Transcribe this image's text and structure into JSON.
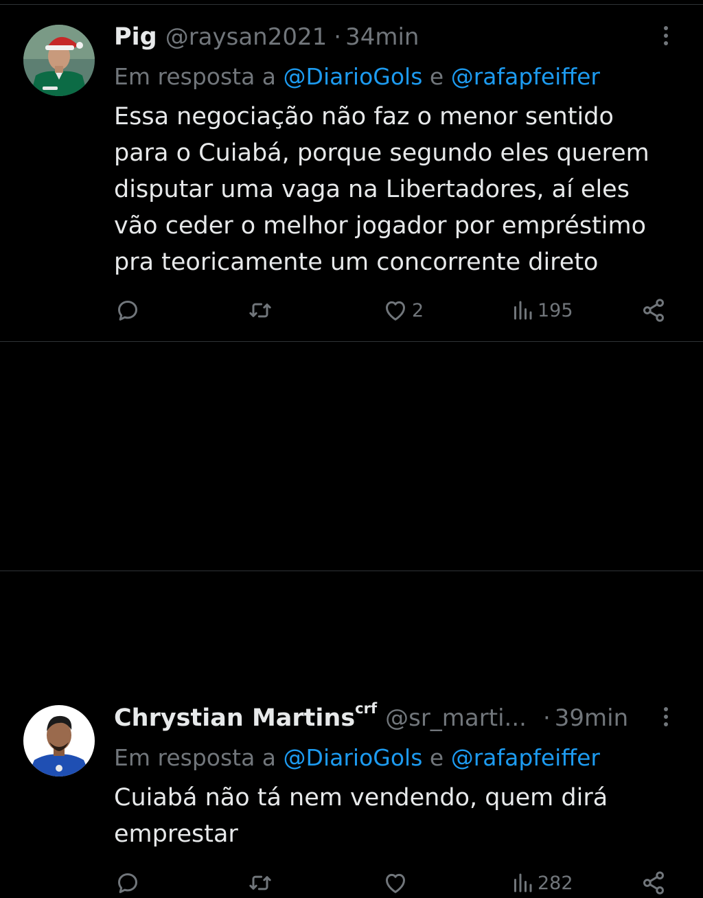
{
  "tweets": [
    {
      "name": "Pig",
      "name_sup": "",
      "handle": "@raysan2021",
      "dot": "·",
      "time": "34min",
      "reply_prefix": "Em resposta a ",
      "reply_mention_1": "@DiarioGols",
      "reply_and": " e ",
      "reply_mention_2": "@rafapfeiffer",
      "text": "Essa negociação não faz o menor sentido\npara o Cuiabá, porque segundo eles querem\ndisputar uma vaga na Libertadores, aí eles\nvão ceder o melhor jogador por empréstimo\npra teoricamente um concorrente direto",
      "likes": "2",
      "views": "195",
      "avatar_colors": {
        "bg": "#5d7f72",
        "jersey": "#0c6b45",
        "hat": "#c62828"
      }
    },
    {
      "name": "Chrystian Martins",
      "name_sup": "crf",
      "handle": "@sr_marti...",
      "dot": "·",
      "time": "39min",
      "reply_prefix": "Em resposta a ",
      "reply_mention_1": "@DiarioGols",
      "reply_and": " e ",
      "reply_mention_2": "@rafapfeiffer",
      "text": "Cuiabá não tá nem vendendo, quem dirá\nemprestar",
      "likes": "",
      "views": "282",
      "avatar_colors": {
        "bg": "#ffffff",
        "shirt": "#1f4fb3",
        "skin": "#9a6a4d"
      }
    }
  ],
  "icons": [
    "reply-icon",
    "retweet-icon",
    "like-icon",
    "views-icon",
    "share-icon",
    "more-icon"
  ],
  "colors": {
    "background": "#000000",
    "text": "#e7e9ea",
    "muted": "#71767b",
    "link": "#1d9bf0",
    "divider": "#2f3336"
  }
}
